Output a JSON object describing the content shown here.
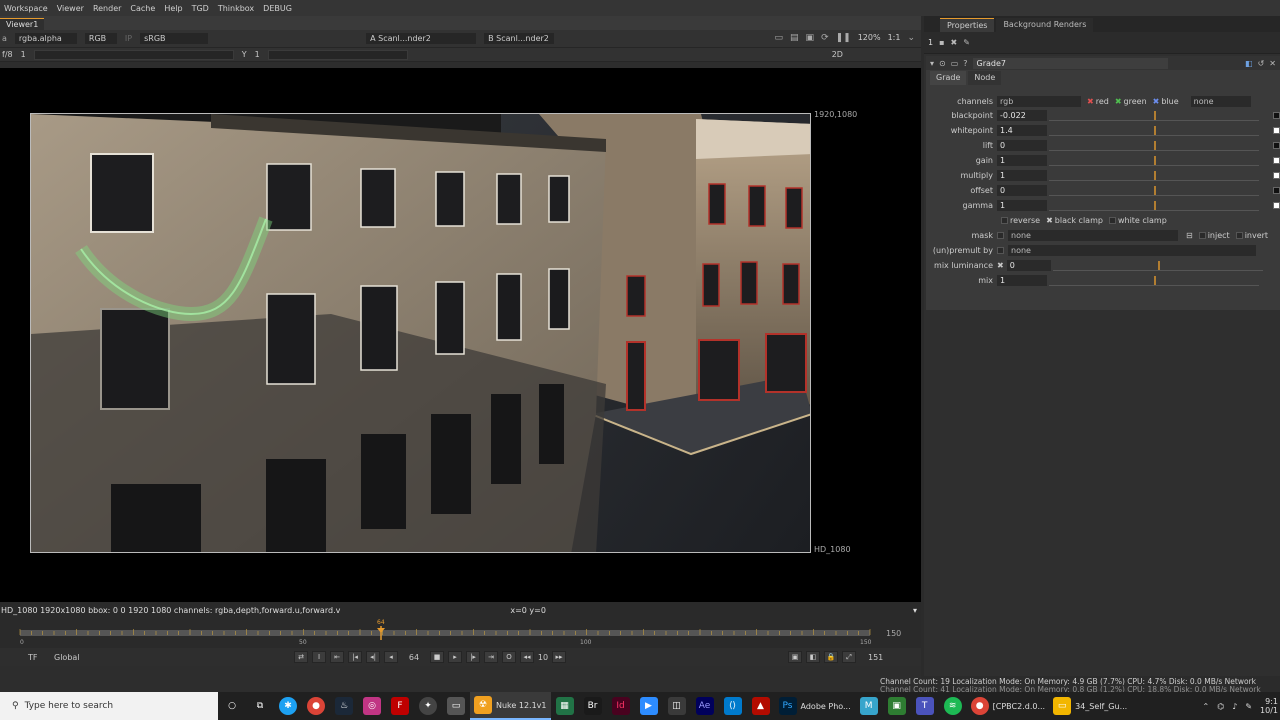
{
  "menu": [
    "Workspace",
    "Viewer",
    "Render",
    "Cache",
    "Help",
    "TGD",
    "Thinkbox",
    "DEBUG"
  ],
  "viewer": {
    "tab": "Viewer1",
    "channels": "rgba.alpha",
    "rgb": "RGB",
    "colorspace": "sRGB",
    "input_a": "A  Scanl...nder2",
    "input_b": "B  Scanl...nder2",
    "zoom": "120%",
    "ratio": "1:1",
    "frame_f": "f/8",
    "frame_1": "1",
    "y_label": "Y",
    "y_val": "1",
    "view_mode": "2D",
    "res_top": "1920,1080",
    "res_bottom": "HD_1080",
    "info_left": "HD_1080 1920x1080  bbox: 0 0 1920 1080 channels: rgba,depth,forward.u,forward.v",
    "info_coords": "x=0 y=0",
    "timeline": {
      "start": "0",
      "tick_50": "50",
      "tick_100": "100",
      "end_label": "150",
      "current": "64",
      "end_box": "150",
      "end_frame": "151"
    },
    "playback": {
      "tf": "TF",
      "global": "Global",
      "frame": "64",
      "step": "10"
    }
  },
  "props": {
    "tabs": [
      "Properties",
      "Background Renders"
    ],
    "toolbar_count": "1",
    "node_name": "Grade7",
    "node_tabs": [
      "Grade",
      "Node"
    ],
    "channels": {
      "label": "channels",
      "value": "rgb",
      "red": "red",
      "green": "green",
      "blue": "blue",
      "extra": "none"
    },
    "knobs": [
      {
        "label": "blackpoint",
        "value": "-0.022"
      },
      {
        "label": "whitepoint",
        "value": "1.4"
      },
      {
        "label": "lift",
        "value": "0"
      },
      {
        "label": "gain",
        "value": "1"
      },
      {
        "label": "multiply",
        "value": "1"
      },
      {
        "label": "offset",
        "value": "0"
      },
      {
        "label": "gamma",
        "value": "1"
      }
    ],
    "checks": {
      "reverse": "reverse",
      "black_clamp": "black clamp",
      "white_clamp": "white clamp"
    },
    "mask": {
      "label": "mask",
      "value": "none",
      "inject": "inject",
      "invert": "invert"
    },
    "unpremult": {
      "label": "(un)premult by",
      "value": "none"
    },
    "mix_luminance": {
      "label": "mix luminance",
      "value": "0"
    },
    "mix": {
      "label": "mix",
      "value": "1"
    },
    "status_line1": "Channel Count: 19  Localization Mode: On  Memory: 4.9 GB (7.7%)  CPU: 4.7%  Disk: 0.0 MB/s  Network",
    "status_line2": "Channel Count: 41  Localization Mode: On  Memory: 0.8 GB (1.2%)  CPU: 18.8%  Disk: 0.0 MB/s  Network"
  },
  "taskbar": {
    "search": "Type here to search",
    "nuke": "Nuke 12.1v1",
    "photoshop": "Adobe Pho...",
    "chrome": "[CPBC2.d.0...",
    "folder": "34_Self_Gu...",
    "time": "9:1",
    "date": "10/1"
  },
  "colors": {
    "accent": "#e69b2e",
    "bg": "#2b2b2b",
    "viewer_bg": "#000000"
  }
}
